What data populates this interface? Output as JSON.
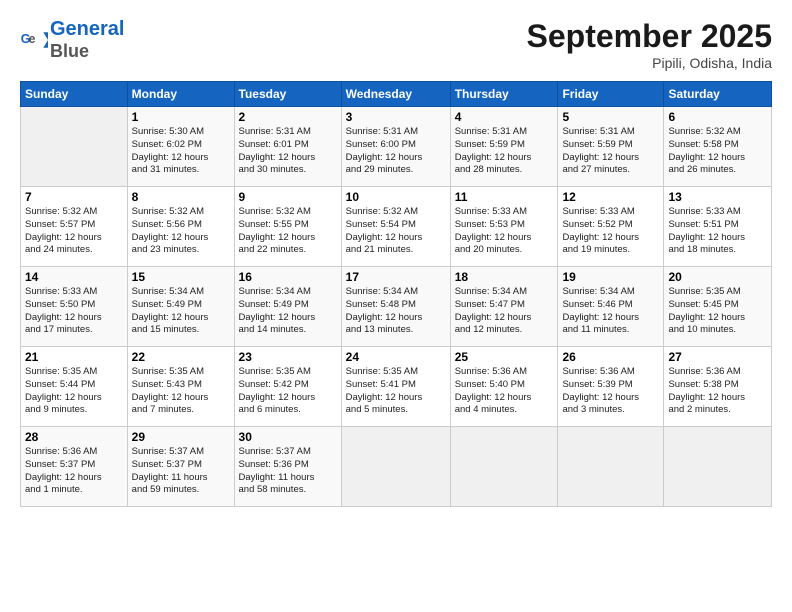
{
  "header": {
    "month_title": "September 2025",
    "subtitle": "Pipili, Odisha, India",
    "logo_line1": "General",
    "logo_line2": "Blue"
  },
  "days_of_week": [
    "Sunday",
    "Monday",
    "Tuesday",
    "Wednesday",
    "Thursday",
    "Friday",
    "Saturday"
  ],
  "weeks": [
    [
      {
        "day": "",
        "info": ""
      },
      {
        "day": "1",
        "info": "Sunrise: 5:30 AM\nSunset: 6:02 PM\nDaylight: 12 hours\nand 31 minutes."
      },
      {
        "day": "2",
        "info": "Sunrise: 5:31 AM\nSunset: 6:01 PM\nDaylight: 12 hours\nand 30 minutes."
      },
      {
        "day": "3",
        "info": "Sunrise: 5:31 AM\nSunset: 6:00 PM\nDaylight: 12 hours\nand 29 minutes."
      },
      {
        "day": "4",
        "info": "Sunrise: 5:31 AM\nSunset: 5:59 PM\nDaylight: 12 hours\nand 28 minutes."
      },
      {
        "day": "5",
        "info": "Sunrise: 5:31 AM\nSunset: 5:59 PM\nDaylight: 12 hours\nand 27 minutes."
      },
      {
        "day": "6",
        "info": "Sunrise: 5:32 AM\nSunset: 5:58 PM\nDaylight: 12 hours\nand 26 minutes."
      }
    ],
    [
      {
        "day": "7",
        "info": "Sunrise: 5:32 AM\nSunset: 5:57 PM\nDaylight: 12 hours\nand 24 minutes."
      },
      {
        "day": "8",
        "info": "Sunrise: 5:32 AM\nSunset: 5:56 PM\nDaylight: 12 hours\nand 23 minutes."
      },
      {
        "day": "9",
        "info": "Sunrise: 5:32 AM\nSunset: 5:55 PM\nDaylight: 12 hours\nand 22 minutes."
      },
      {
        "day": "10",
        "info": "Sunrise: 5:32 AM\nSunset: 5:54 PM\nDaylight: 12 hours\nand 21 minutes."
      },
      {
        "day": "11",
        "info": "Sunrise: 5:33 AM\nSunset: 5:53 PM\nDaylight: 12 hours\nand 20 minutes."
      },
      {
        "day": "12",
        "info": "Sunrise: 5:33 AM\nSunset: 5:52 PM\nDaylight: 12 hours\nand 19 minutes."
      },
      {
        "day": "13",
        "info": "Sunrise: 5:33 AM\nSunset: 5:51 PM\nDaylight: 12 hours\nand 18 minutes."
      }
    ],
    [
      {
        "day": "14",
        "info": "Sunrise: 5:33 AM\nSunset: 5:50 PM\nDaylight: 12 hours\nand 17 minutes."
      },
      {
        "day": "15",
        "info": "Sunrise: 5:34 AM\nSunset: 5:49 PM\nDaylight: 12 hours\nand 15 minutes."
      },
      {
        "day": "16",
        "info": "Sunrise: 5:34 AM\nSunset: 5:49 PM\nDaylight: 12 hours\nand 14 minutes."
      },
      {
        "day": "17",
        "info": "Sunrise: 5:34 AM\nSunset: 5:48 PM\nDaylight: 12 hours\nand 13 minutes."
      },
      {
        "day": "18",
        "info": "Sunrise: 5:34 AM\nSunset: 5:47 PM\nDaylight: 12 hours\nand 12 minutes."
      },
      {
        "day": "19",
        "info": "Sunrise: 5:34 AM\nSunset: 5:46 PM\nDaylight: 12 hours\nand 11 minutes."
      },
      {
        "day": "20",
        "info": "Sunrise: 5:35 AM\nSunset: 5:45 PM\nDaylight: 12 hours\nand 10 minutes."
      }
    ],
    [
      {
        "day": "21",
        "info": "Sunrise: 5:35 AM\nSunset: 5:44 PM\nDaylight: 12 hours\nand 9 minutes."
      },
      {
        "day": "22",
        "info": "Sunrise: 5:35 AM\nSunset: 5:43 PM\nDaylight: 12 hours\nand 7 minutes."
      },
      {
        "day": "23",
        "info": "Sunrise: 5:35 AM\nSunset: 5:42 PM\nDaylight: 12 hours\nand 6 minutes."
      },
      {
        "day": "24",
        "info": "Sunrise: 5:35 AM\nSunset: 5:41 PM\nDaylight: 12 hours\nand 5 minutes."
      },
      {
        "day": "25",
        "info": "Sunrise: 5:36 AM\nSunset: 5:40 PM\nDaylight: 12 hours\nand 4 minutes."
      },
      {
        "day": "26",
        "info": "Sunrise: 5:36 AM\nSunset: 5:39 PM\nDaylight: 12 hours\nand 3 minutes."
      },
      {
        "day": "27",
        "info": "Sunrise: 5:36 AM\nSunset: 5:38 PM\nDaylight: 12 hours\nand 2 minutes."
      }
    ],
    [
      {
        "day": "28",
        "info": "Sunrise: 5:36 AM\nSunset: 5:37 PM\nDaylight: 12 hours\nand 1 minute."
      },
      {
        "day": "29",
        "info": "Sunrise: 5:37 AM\nSunset: 5:37 PM\nDaylight: 11 hours\nand 59 minutes."
      },
      {
        "day": "30",
        "info": "Sunrise: 5:37 AM\nSunset: 5:36 PM\nDaylight: 11 hours\nand 58 minutes."
      },
      {
        "day": "",
        "info": ""
      },
      {
        "day": "",
        "info": ""
      },
      {
        "day": "",
        "info": ""
      },
      {
        "day": "",
        "info": ""
      }
    ]
  ]
}
